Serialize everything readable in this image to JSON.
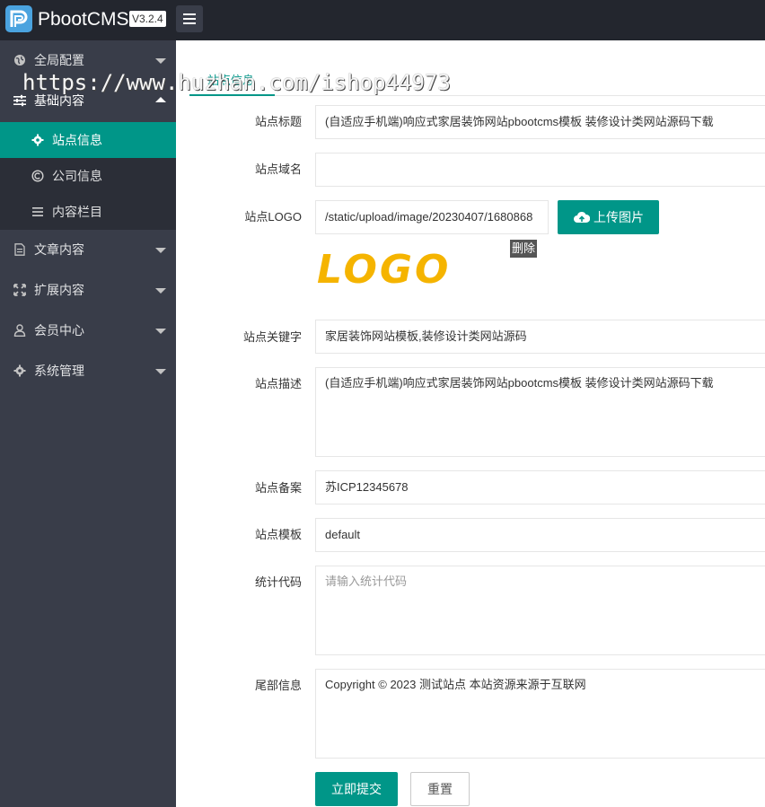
{
  "header": {
    "app_name": "PbootCMS",
    "version": "V3.2.4"
  },
  "sidebar": {
    "groups": [
      {
        "label": "全局配置",
        "icon": "globe-icon"
      },
      {
        "label": "基础内容",
        "icon": "sliders-icon"
      },
      {
        "label": "文章内容",
        "icon": "file-icon"
      },
      {
        "label": "扩展内容",
        "icon": "expand-icon"
      },
      {
        "label": "会员中心",
        "icon": "user-icon"
      },
      {
        "label": "系统管理",
        "icon": "gear-icon"
      }
    ],
    "sub_items": [
      {
        "label": "站点信息",
        "icon": "gear-icon",
        "active": true
      },
      {
        "label": "公司信息",
        "icon": "copyright-icon",
        "active": false
      },
      {
        "label": "内容栏目",
        "icon": "list-icon",
        "active": false
      }
    ]
  },
  "main": {
    "tab": "站点信息",
    "watermark": "https://www.huzhan.com/ishop44973",
    "fields": {
      "site_title": {
        "label": "站点标题",
        "value": "(自适应手机端)响应式家居装饰网站pbootcms模板 装修设计类网站源码下载"
      },
      "site_domain": {
        "label": "站点域名",
        "value": ""
      },
      "site_logo": {
        "label": "站点LOGO",
        "value": "/static/upload/image/20230407/1680868"
      },
      "site_keywords": {
        "label": "站点关键字",
        "value": "家居装饰网站模板,装修设计类网站源码"
      },
      "site_description": {
        "label": "站点描述",
        "value": "(自适应手机端)响应式家居装饰网站pbootcms模板 装修设计类网站源码下载"
      },
      "site_icp": {
        "label": "站点备案",
        "value": "苏ICP12345678"
      },
      "site_template": {
        "label": "站点模板",
        "value": "default"
      },
      "stats_code": {
        "label": "统计代码",
        "value": "",
        "placeholder": "请输入统计代码"
      },
      "footer_info": {
        "label": "尾部信息",
        "value": "Copyright © 2023 测试站点 本站资源来源于互联网"
      }
    },
    "upload_label": "上传图片",
    "delete_label": "删除",
    "logo_text": "LOGO",
    "submit_label": "立即提交",
    "reset_label": "重置"
  },
  "colors": {
    "accent": "#009688",
    "topbar": "#23262e",
    "sidebar": "#393d49",
    "submenu": "#2b2e37",
    "logo_yellow": "#f5b400"
  }
}
